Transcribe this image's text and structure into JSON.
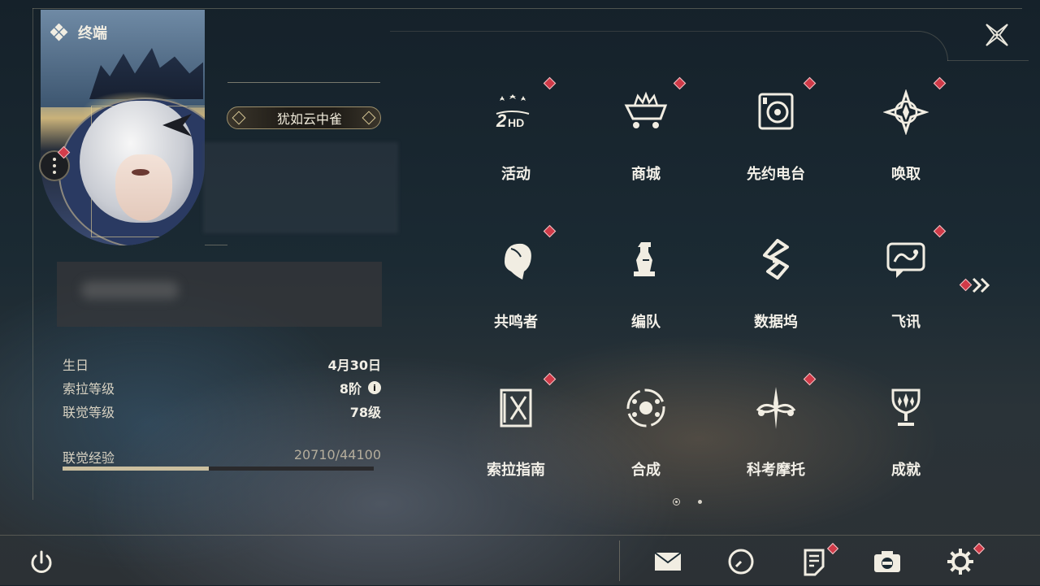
{
  "header": {
    "title": "终端"
  },
  "profile": {
    "title_badge": "犹如云中雀",
    "has_notice": true
  },
  "info": [
    {
      "key": "生日",
      "value": "4月30日"
    },
    {
      "key": "索拉等级",
      "value": "8阶",
      "has_info": true
    },
    {
      "key": "联觉等级",
      "value": "78级"
    }
  ],
  "exp": {
    "label": "联觉经验",
    "value": "20710/44100",
    "progress": 0.4696
  },
  "menu": {
    "items": [
      {
        "label": "活动",
        "icon": "event-2hd-icon",
        "notice": true
      },
      {
        "label": "商城",
        "icon": "shop-cart-icon",
        "notice": true
      },
      {
        "label": "先约电台",
        "icon": "radio-icon",
        "notice": true
      },
      {
        "label": "唤取",
        "icon": "summon-compass-icon",
        "notice": true
      },
      {
        "label": "共鸣者",
        "icon": "resonator-head-icon",
        "notice": true
      },
      {
        "label": "编队",
        "icon": "team-chess-icon",
        "notice": false
      },
      {
        "label": "数据坞",
        "icon": "data-dock-icon",
        "notice": false
      },
      {
        "label": "飞讯",
        "icon": "message-bubble-icon",
        "notice": true
      },
      {
        "label": "索拉指南",
        "icon": "guide-book-icon",
        "notice": true
      },
      {
        "label": "合成",
        "icon": "synthesis-icon",
        "notice": false
      },
      {
        "label": "科考摩托",
        "icon": "motorcycle-icon",
        "notice": true
      },
      {
        "label": "成就",
        "icon": "trophy-icon",
        "notice": false
      }
    ],
    "next_notice": true,
    "pages": 2,
    "current_page": 1
  },
  "bottom_bar": [
    {
      "name": "mail",
      "icon": "mail-icon",
      "notice": false
    },
    {
      "name": "clock",
      "icon": "clock-icon",
      "notice": false
    },
    {
      "name": "notice",
      "icon": "notice-board-icon",
      "notice": true
    },
    {
      "name": "camera",
      "icon": "camera-icon",
      "notice": false
    },
    {
      "name": "settings",
      "icon": "gear-icon",
      "notice": true
    }
  ],
  "colors": {
    "accent": "#d03a48",
    "gold": "#cbbf9f",
    "text": "#f3f0e8"
  }
}
